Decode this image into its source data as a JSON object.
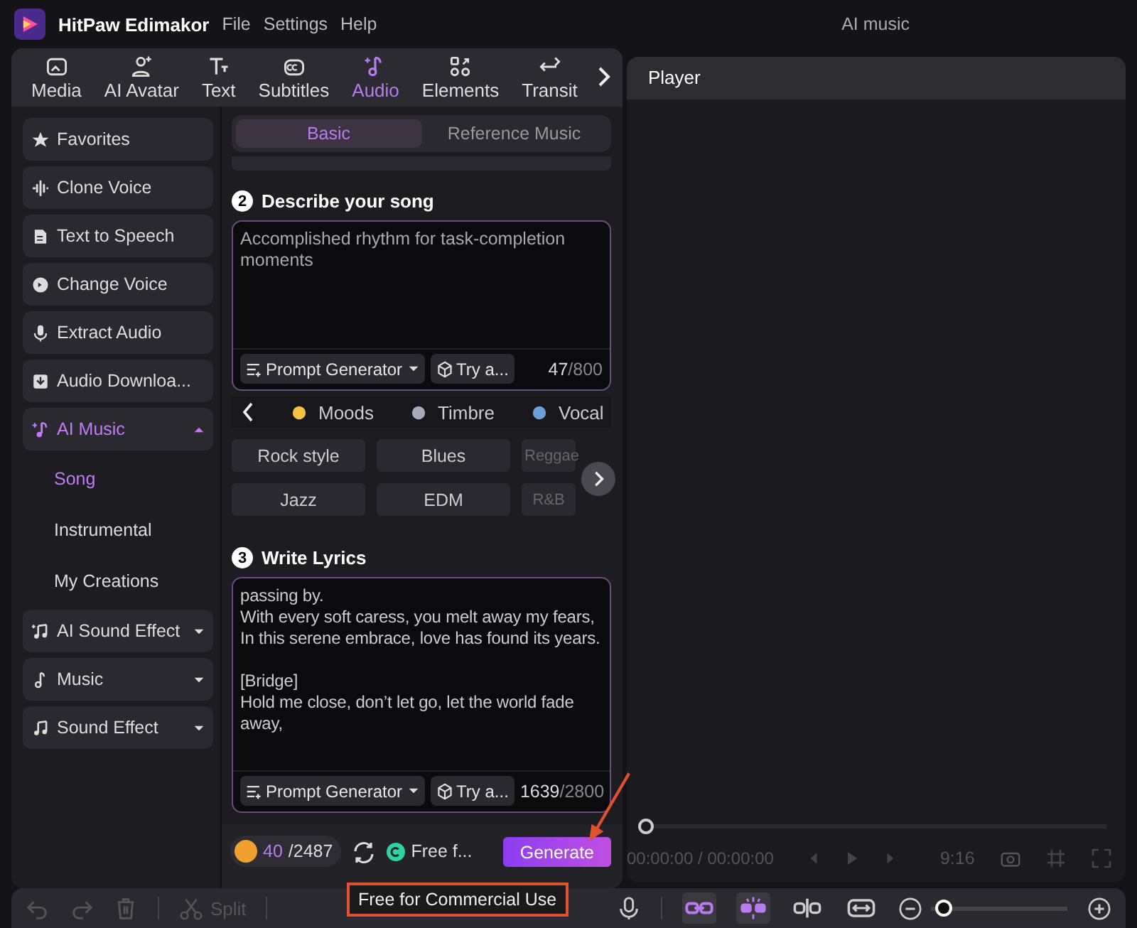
{
  "app": {
    "name": "HitPaw Edimakor",
    "menu": [
      "File",
      "Settings",
      "Help"
    ],
    "title": "AI music"
  },
  "tabs": [
    {
      "label": "Media",
      "selected": false
    },
    {
      "label": "AI Avatar",
      "selected": false
    },
    {
      "label": "Text",
      "selected": false
    },
    {
      "label": "Subtitles",
      "selected": false
    },
    {
      "label": "Audio",
      "selected": true
    },
    {
      "label": "Elements",
      "selected": false
    },
    {
      "label": "Transit",
      "selected": false
    }
  ],
  "sidebar": [
    {
      "label": "Favorites",
      "kind": "item",
      "selected": false
    },
    {
      "label": "Clone Voice",
      "kind": "item",
      "selected": false
    },
    {
      "label": "Text to Speech",
      "kind": "item",
      "selected": false
    },
    {
      "label": "Change Voice",
      "kind": "item",
      "selected": false
    },
    {
      "label": "Extract Audio",
      "kind": "item",
      "selected": false
    },
    {
      "label": "Audio Downloa...",
      "kind": "item",
      "selected": false
    },
    {
      "label": "AI Music",
      "kind": "group",
      "selected": true,
      "expanded": true,
      "children": [
        {
          "label": "Song",
          "selected": true
        },
        {
          "label": "Instrumental",
          "selected": false
        },
        {
          "label": "My Creations",
          "selected": false
        }
      ]
    },
    {
      "label": "AI Sound Effect",
      "kind": "group",
      "selected": false,
      "expanded": false
    },
    {
      "label": "Music",
      "kind": "group",
      "selected": false,
      "expanded": false
    },
    {
      "label": "Sound Effect",
      "kind": "group",
      "selected": false,
      "expanded": false
    }
  ],
  "mode_tabs": [
    {
      "label": "Basic",
      "selected": true
    },
    {
      "label": "Reference Music",
      "selected": false
    }
  ],
  "describe": {
    "step": "2",
    "title": "Describe your song",
    "value": "Accomplished rhythm for task-completion moments",
    "prompt_button": "Prompt Generator",
    "try_button": "Try a...",
    "count": "47",
    "max": "/800"
  },
  "categories": [
    {
      "label": "Moods"
    },
    {
      "label": "Timbre"
    },
    {
      "label": "Vocal"
    }
  ],
  "styles": [
    "Rock style",
    "Blues",
    "Reggae",
    "Jazz",
    "EDM",
    "R&B"
  ],
  "lyrics": {
    "step": "3",
    "title": "Write Lyrics",
    "value": "passing by.\nWith every soft caress, you melt away my fears,\nIn this serene embrace, love has found its years.\n\n[Bridge]\nHold me close, don’t let go, let the world fade away,",
    "prompt_button": "Prompt Generator",
    "try_button": "Try a...",
    "count": "1639",
    "max": "/2800"
  },
  "footer": {
    "credits_used": "40",
    "credits_total": "/2487",
    "license": "Free f...",
    "generate": "Generate"
  },
  "tooltip": "Free for Commercial Use",
  "player": {
    "title": "Player",
    "level": 0,
    "time": "00:00:00 / 00:00:00",
    "ratio": "9:16"
  },
  "toolbar": {
    "split": "Split",
    "tools": [
      {
        "selected": true
      },
      {
        "selected": true
      },
      {
        "selected": false
      },
      {
        "selected": false
      }
    ],
    "zoom": {
      "level": 0.03
    }
  }
}
